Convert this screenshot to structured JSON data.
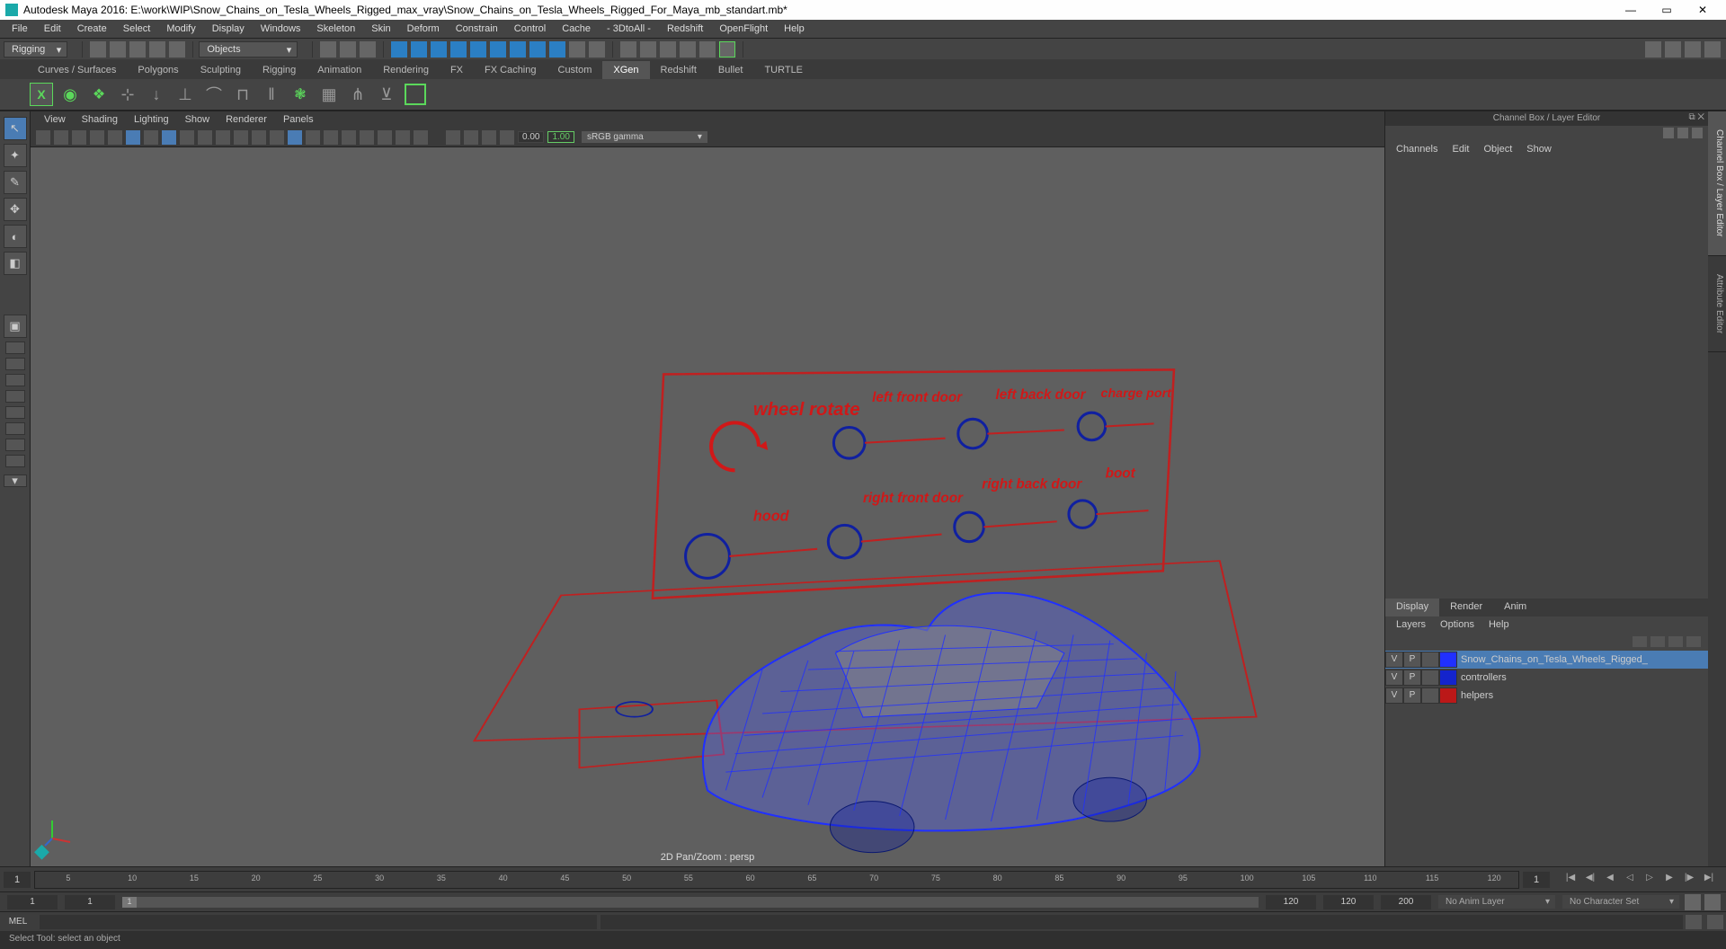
{
  "title": "Autodesk Maya 2016: E:\\work\\WIP\\Snow_Chains_on_Tesla_Wheels_Rigged_max_vray\\Snow_Chains_on_Tesla_Wheels_Rigged_For_Maya_mb_standart.mb*",
  "mainMenu": [
    "File",
    "Edit",
    "Create",
    "Select",
    "Modify",
    "Display",
    "Windows",
    "Skeleton",
    "Skin",
    "Deform",
    "Constrain",
    "Control",
    "Cache",
    "- 3DtoAll -",
    "Redshift",
    "OpenFlight",
    "Help"
  ],
  "moduleDropdown": "Rigging",
  "objectsDropdown": "Objects",
  "shelfTabs": [
    "Curves / Surfaces",
    "Polygons",
    "Sculpting",
    "Rigging",
    "Animation",
    "Rendering",
    "FX",
    "FX Caching",
    "Custom",
    "XGen",
    "Redshift",
    "Bullet",
    "TURTLE"
  ],
  "shelfActive": "XGen",
  "viewportMenu": [
    "View",
    "Shading",
    "Lighting",
    "Show",
    "Renderer",
    "Panels"
  ],
  "viewportVals": {
    "a": "0.00",
    "b": "1.00"
  },
  "colorSpace": "sRGB gamma",
  "viewportFooter": "2D Pan/Zoom : persp",
  "channelBox": {
    "title": "Channel Box / Layer Editor",
    "menus": [
      "Channels",
      "Edit",
      "Object",
      "Show"
    ]
  },
  "layerTabs": [
    "Display",
    "Render",
    "Anim"
  ],
  "layerTabActive": "Display",
  "layerMenu": [
    "Layers",
    "Options",
    "Help"
  ],
  "layers": [
    {
      "name": "Snow_Chains_on_Tesla_Wheels_Rigged_",
      "v": "V",
      "p": "P",
      "color": "#2030ff",
      "sel": true
    },
    {
      "name": "controllers",
      "v": "V",
      "p": "P",
      "color": "#1424cc",
      "sel": false
    },
    {
      "name": "helpers",
      "v": "V",
      "p": "P",
      "color": "#bb1818",
      "sel": false
    }
  ],
  "rightTabs": [
    "Channel Box / Layer Editor",
    "Attribute Editor"
  ],
  "timeline": {
    "start": "1",
    "startFrame": "1",
    "ticks": [
      "5",
      "10",
      "15",
      "20",
      "25",
      "30",
      "35",
      "40",
      "45",
      "50",
      "55",
      "60",
      "65",
      "70",
      "75",
      "80",
      "85",
      "90",
      "95",
      "100",
      "105",
      "110",
      "115",
      "120"
    ],
    "cur": "1"
  },
  "range": {
    "a": "1",
    "b": "1",
    "c": "120",
    "d": "120",
    "e": "200",
    "animLayer": "No Anim Layer",
    "charSet": "No Character Set"
  },
  "cmd": "MEL",
  "help": "Select Tool: select an object",
  "rigLabels": {
    "wheelRotate": "wheel rotate",
    "leftFrontDoor": "left front door",
    "leftBackDoor": "left back door",
    "chargePort": "charge port",
    "hood": "hood",
    "rightFrontDoor": "right front door",
    "rightBackDoor": "right back door",
    "boot": "boot"
  }
}
